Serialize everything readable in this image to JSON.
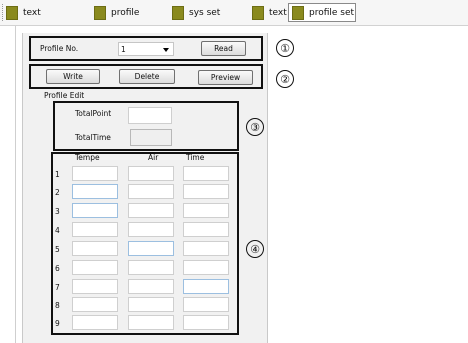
{
  "toolbar": {
    "items": [
      {
        "label": "text"
      },
      {
        "label": "profile"
      },
      {
        "label": "sys set"
      },
      {
        "label": "text set"
      },
      {
        "label": "profile set"
      }
    ]
  },
  "profile_select": {
    "label": "Profile No.",
    "value": "1",
    "read_label": "Read"
  },
  "actions": {
    "write_label": "Write",
    "delete_label": "Delete",
    "preview_label": "Preview"
  },
  "profile_edit": {
    "title": "Profile Edit",
    "total_point_label": "TotalPoint",
    "total_time_label": "TotalTime"
  },
  "table": {
    "headers": [
      "Tempe",
      "Air",
      "Time"
    ],
    "rows": [
      "1",
      "2",
      "3",
      "4",
      "5",
      "6",
      "7",
      "8",
      "9"
    ]
  },
  "callouts": [
    "①",
    "②",
    "③",
    "④"
  ]
}
